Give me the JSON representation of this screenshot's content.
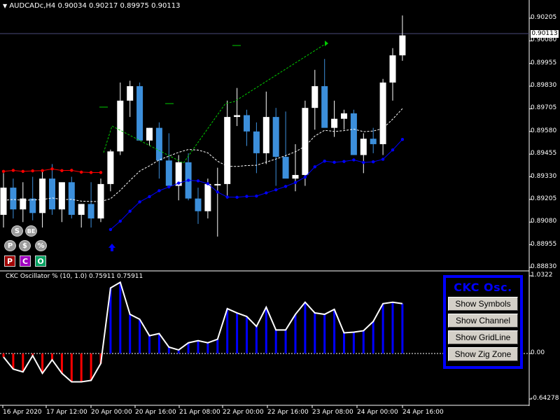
{
  "symbol_header": {
    "symbol": "AUDCADc,H4",
    "ohlc": "0.90034 0.90217 0.89975 0.90113"
  },
  "current_price": "0.90113",
  "price_axis": [
    "0.90205",
    "0.90080",
    "0.89955",
    "0.89830",
    "0.89705",
    "0.89580",
    "0.89455",
    "0.89330",
    "0.89205",
    "0.89080",
    "0.88955",
    "0.88830"
  ],
  "oscillator": {
    "title": "CKC Oscillator % (10, 1.0) 0.75911 0.75911",
    "axis": [
      "1.0322",
      "0.00",
      "-0.64278"
    ]
  },
  "date_axis": [
    "16 Apr 2020",
    "17 Apr 12:00",
    "20 Apr 00:00",
    "20 Apr 16:00",
    "21 Apr 08:00",
    "22 Apr 00:00",
    "22 Apr 16:00",
    "23 Apr 08:00",
    "24 Apr 00:00",
    "24 Apr 16:00"
  ],
  "panel": {
    "title": "CKC Osc.",
    "buttons": [
      "Show Symbols",
      "Show Channel",
      "Show GridLine",
      "Show Zig Zone"
    ]
  },
  "toolbar": {
    "row1": [
      "S",
      "BE"
    ],
    "row2": [
      "P",
      "$",
      "%"
    ],
    "row3": [
      "P",
      "C",
      "O"
    ]
  },
  "colors": {
    "bull": "#ffffff",
    "bear": "#3c8fdb",
    "upper_band": "#ff0000",
    "lower_band": "#0000ff",
    "mid": "#ffffff",
    "zigzag": "#00cc00",
    "osc_pos": "#0000ff",
    "osc_neg": "#ff0000"
  },
  "chart_data": {
    "type": "candlestick",
    "ylim": [
      0.8882,
      0.9026
    ],
    "candles": [
      {
        "o": 0.8912,
        "h": 0.8935,
        "l": 0.8905,
        "c": 0.8927
      },
      {
        "o": 0.8927,
        "h": 0.8932,
        "l": 0.891,
        "c": 0.8915
      },
      {
        "o": 0.8915,
        "h": 0.893,
        "l": 0.8908,
        "c": 0.8921
      },
      {
        "o": 0.8921,
        "h": 0.8933,
        "l": 0.8909,
        "c": 0.8913
      },
      {
        "o": 0.8913,
        "h": 0.8937,
        "l": 0.8905,
        "c": 0.8932
      },
      {
        "o": 0.8932,
        "h": 0.894,
        "l": 0.8912,
        "c": 0.8915
      },
      {
        "o": 0.8915,
        "h": 0.8922,
        "l": 0.8908,
        "c": 0.893
      },
      {
        "o": 0.893,
        "h": 0.8933,
        "l": 0.891,
        "c": 0.8912
      },
      {
        "o": 0.8912,
        "h": 0.8918,
        "l": 0.8905,
        "c": 0.8918
      },
      {
        "o": 0.8918,
        "h": 0.893,
        "l": 0.8905,
        "c": 0.891
      },
      {
        "o": 0.891,
        "h": 0.8932,
        "l": 0.8908,
        "c": 0.8929
      },
      {
        "o": 0.8929,
        "h": 0.8948,
        "l": 0.8925,
        "c": 0.8947
      },
      {
        "o": 0.8947,
        "h": 0.8985,
        "l": 0.8945,
        "c": 0.8975
      },
      {
        "o": 0.8975,
        "h": 0.8986,
        "l": 0.8966,
        "c": 0.8983
      },
      {
        "o": 0.8983,
        "h": 0.8985,
        "l": 0.896,
        "c": 0.8953
      },
      {
        "o": 0.8953,
        "h": 0.896,
        "l": 0.895,
        "c": 0.896
      },
      {
        "o": 0.896,
        "h": 0.8963,
        "l": 0.8932,
        "c": 0.8942
      },
      {
        "o": 0.8942,
        "h": 0.8957,
        "l": 0.8928,
        "c": 0.8928
      },
      {
        "o": 0.8928,
        "h": 0.8945,
        "l": 0.892,
        "c": 0.8941
      },
      {
        "o": 0.8941,
        "h": 0.8946,
        "l": 0.892,
        "c": 0.8921
      },
      {
        "o": 0.8921,
        "h": 0.8927,
        "l": 0.8907,
        "c": 0.8914
      },
      {
        "o": 0.8914,
        "h": 0.8932,
        "l": 0.891,
        "c": 0.8929
      },
      {
        "o": 0.8929,
        "h": 0.8938,
        "l": 0.89,
        "c": 0.8929
      },
      {
        "o": 0.8929,
        "h": 0.8975,
        "l": 0.8921,
        "c": 0.8966
      },
      {
        "o": 0.8966,
        "h": 0.8982,
        "l": 0.8961,
        "c": 0.8967
      },
      {
        "o": 0.8967,
        "h": 0.897,
        "l": 0.895,
        "c": 0.8958
      },
      {
        "o": 0.8958,
        "h": 0.8963,
        "l": 0.8935,
        "c": 0.8946
      },
      {
        "o": 0.8946,
        "h": 0.898,
        "l": 0.894,
        "c": 0.8966
      },
      {
        "o": 0.8966,
        "h": 0.8971,
        "l": 0.8928,
        "c": 0.8944
      },
      {
        "o": 0.8944,
        "h": 0.8969,
        "l": 0.8935,
        "c": 0.8932
      },
      {
        "o": 0.8932,
        "h": 0.8951,
        "l": 0.8925,
        "c": 0.8934
      },
      {
        "o": 0.8934,
        "h": 0.8975,
        "l": 0.8928,
        "c": 0.8971
      },
      {
        "o": 0.8971,
        "h": 0.8992,
        "l": 0.8959,
        "c": 0.8983
      },
      {
        "o": 0.8983,
        "h": 0.8998,
        "l": 0.8961,
        "c": 0.896
      },
      {
        "o": 0.896,
        "h": 0.8975,
        "l": 0.8955,
        "c": 0.8965
      },
      {
        "o": 0.8965,
        "h": 0.897,
        "l": 0.8959,
        "c": 0.8968
      },
      {
        "o": 0.8968,
        "h": 0.897,
        "l": 0.8945,
        "c": 0.8945
      },
      {
        "o": 0.8945,
        "h": 0.8957,
        "l": 0.8935,
        "c": 0.8954
      },
      {
        "o": 0.8954,
        "h": 0.896,
        "l": 0.8946,
        "c": 0.8951
      },
      {
        "o": 0.8951,
        "h": 0.8987,
        "l": 0.8945,
        "c": 0.8985
      },
      {
        "o": 0.8985,
        "h": 0.9004,
        "l": 0.8975,
        "c": 0.9
      },
      {
        "o": 0.9,
        "h": 0.9022,
        "l": 0.8997,
        "c": 0.9011
      }
    ],
    "oscillator_values": [
      -0.05,
      -0.22,
      -0.26,
      -0.03,
      -0.28,
      -0.09,
      -0.28,
      -0.4,
      -0.4,
      -0.38,
      -0.14,
      0.92,
      1.0,
      0.55,
      0.48,
      0.25,
      0.28,
      0.09,
      0.05,
      0.15,
      0.18,
      0.15,
      0.2,
      0.63,
      0.57,
      0.52,
      0.38,
      0.65,
      0.33,
      0.33,
      0.55,
      0.72,
      0.57,
      0.55,
      0.62,
      0.29,
      0.3,
      0.32,
      0.45,
      0.7,
      0.72,
      0.7
    ]
  }
}
